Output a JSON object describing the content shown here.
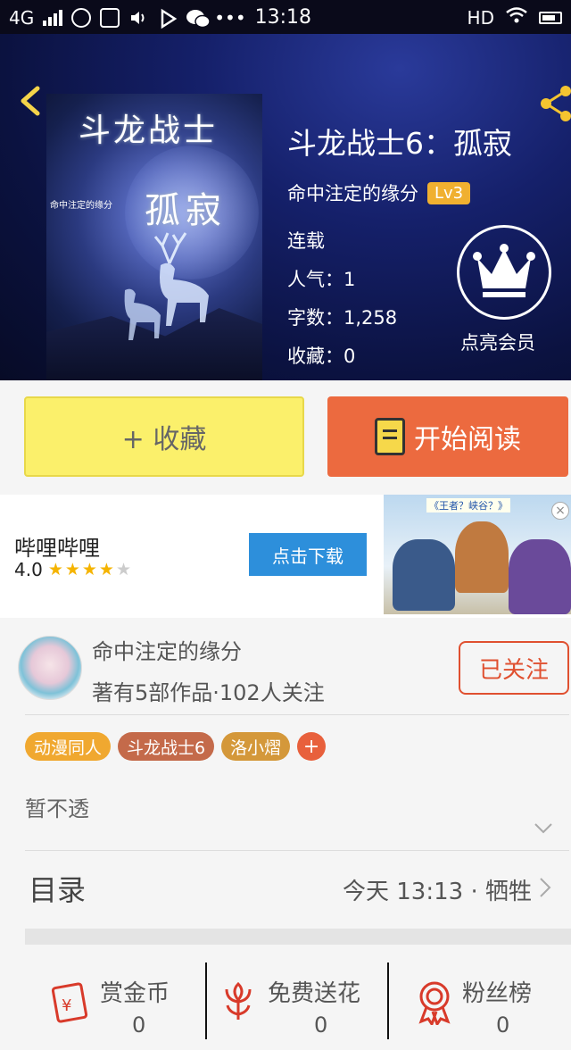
{
  "status_bar": {
    "network": "4G",
    "time": "13:18",
    "hd": "HD"
  },
  "header": {
    "cover": {
      "title_line1": "斗龙战士",
      "title_line2": "孤寂",
      "author_small": "命中注定的缘分"
    },
    "title": "斗龙战士6：孤寂",
    "author": "命中注定的缘分",
    "level": "Lv3",
    "status": "连载",
    "popularity": "人气：1",
    "word_count": "字数：1,258",
    "favorites": "收藏：0",
    "vip_label": "点亮会员"
  },
  "actions": {
    "favorite": "+ 收藏",
    "read": "开始阅读"
  },
  "ad": {
    "app_name": "哔哩哔哩",
    "rating": "4.0",
    "stars": 4,
    "download": "点击下载",
    "image_caption": "《王者？峡谷？》"
  },
  "author_card": {
    "name": "命中注定的缘分",
    "meta": "著有5部作品·102人关注",
    "follow": "已关注",
    "tags": [
      {
        "label": "动漫同人",
        "color": "#f0a830"
      },
      {
        "label": "斗龙战士6",
        "color": "#c46a4a"
      },
      {
        "label": "洛小熠",
        "color": "#d4983a"
      }
    ],
    "tag_add": "+",
    "description": "暂不透"
  },
  "toc": {
    "title": "目录",
    "latest": "今天 13:13 · 牺牲"
  },
  "stats": [
    {
      "icon": "red-envelope-icon",
      "label": "赏金币",
      "value": "0"
    },
    {
      "icon": "flower-icon",
      "label": "免费送花",
      "value": "0"
    },
    {
      "icon": "medal-icon",
      "label": "粉丝榜",
      "value": "0"
    }
  ],
  "colors": {
    "accent_orange": "#ec6a3f",
    "favorite_yellow": "#fbf06b",
    "follow_red": "#e05030",
    "ad_blue": "#2d8fdb"
  }
}
